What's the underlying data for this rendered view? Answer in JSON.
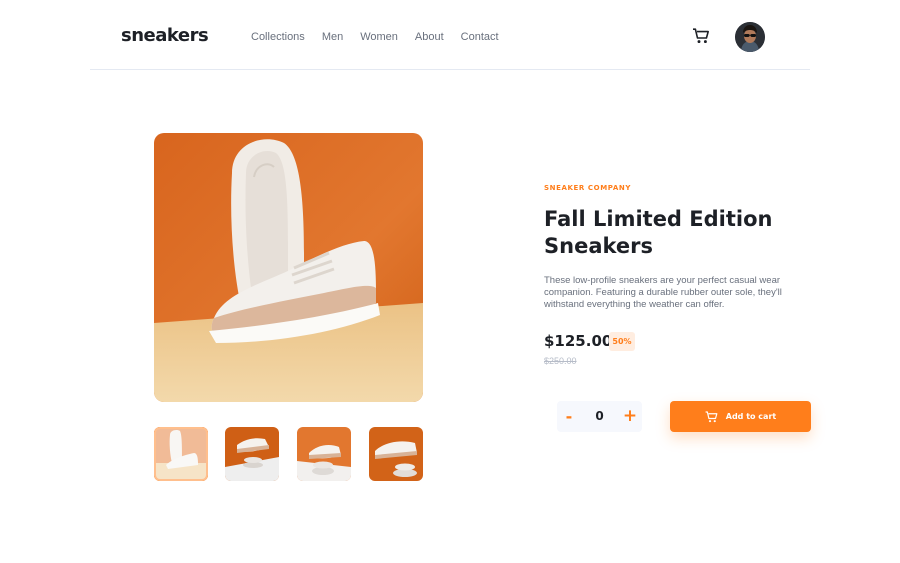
{
  "header": {
    "logo": "sneakers",
    "nav": [
      "Collections",
      "Men",
      "Women",
      "About",
      "Contact"
    ],
    "icons": {
      "cart": "cart-icon",
      "avatar": "user-avatar"
    }
  },
  "gallery": {
    "main_image": "product-image-1",
    "thumbnails": [
      "thumbnail-1",
      "thumbnail-2",
      "thumbnail-3",
      "thumbnail-4"
    ],
    "active_index": 0
  },
  "product": {
    "company": "SNEAKER COMPANY",
    "title": "Fall Limited Edition Sneakers",
    "description": "These low-profile sneakers are your perfect casual wear companion. Featuring a durable rubber outer sole, they'll withstand everything the weather can offer.",
    "price": "$125.00",
    "discount": "50%",
    "original_price": "$250.00"
  },
  "cart_controls": {
    "minus": "-",
    "quantity": "0",
    "plus": "+",
    "add_label": "Add to cart"
  },
  "colors": {
    "accent": "#ff7e1b",
    "accent_pale": "#ffede0",
    "text_dark": "#1d2026",
    "text_gray": "#69707d",
    "text_light": "#b6bcc8"
  }
}
